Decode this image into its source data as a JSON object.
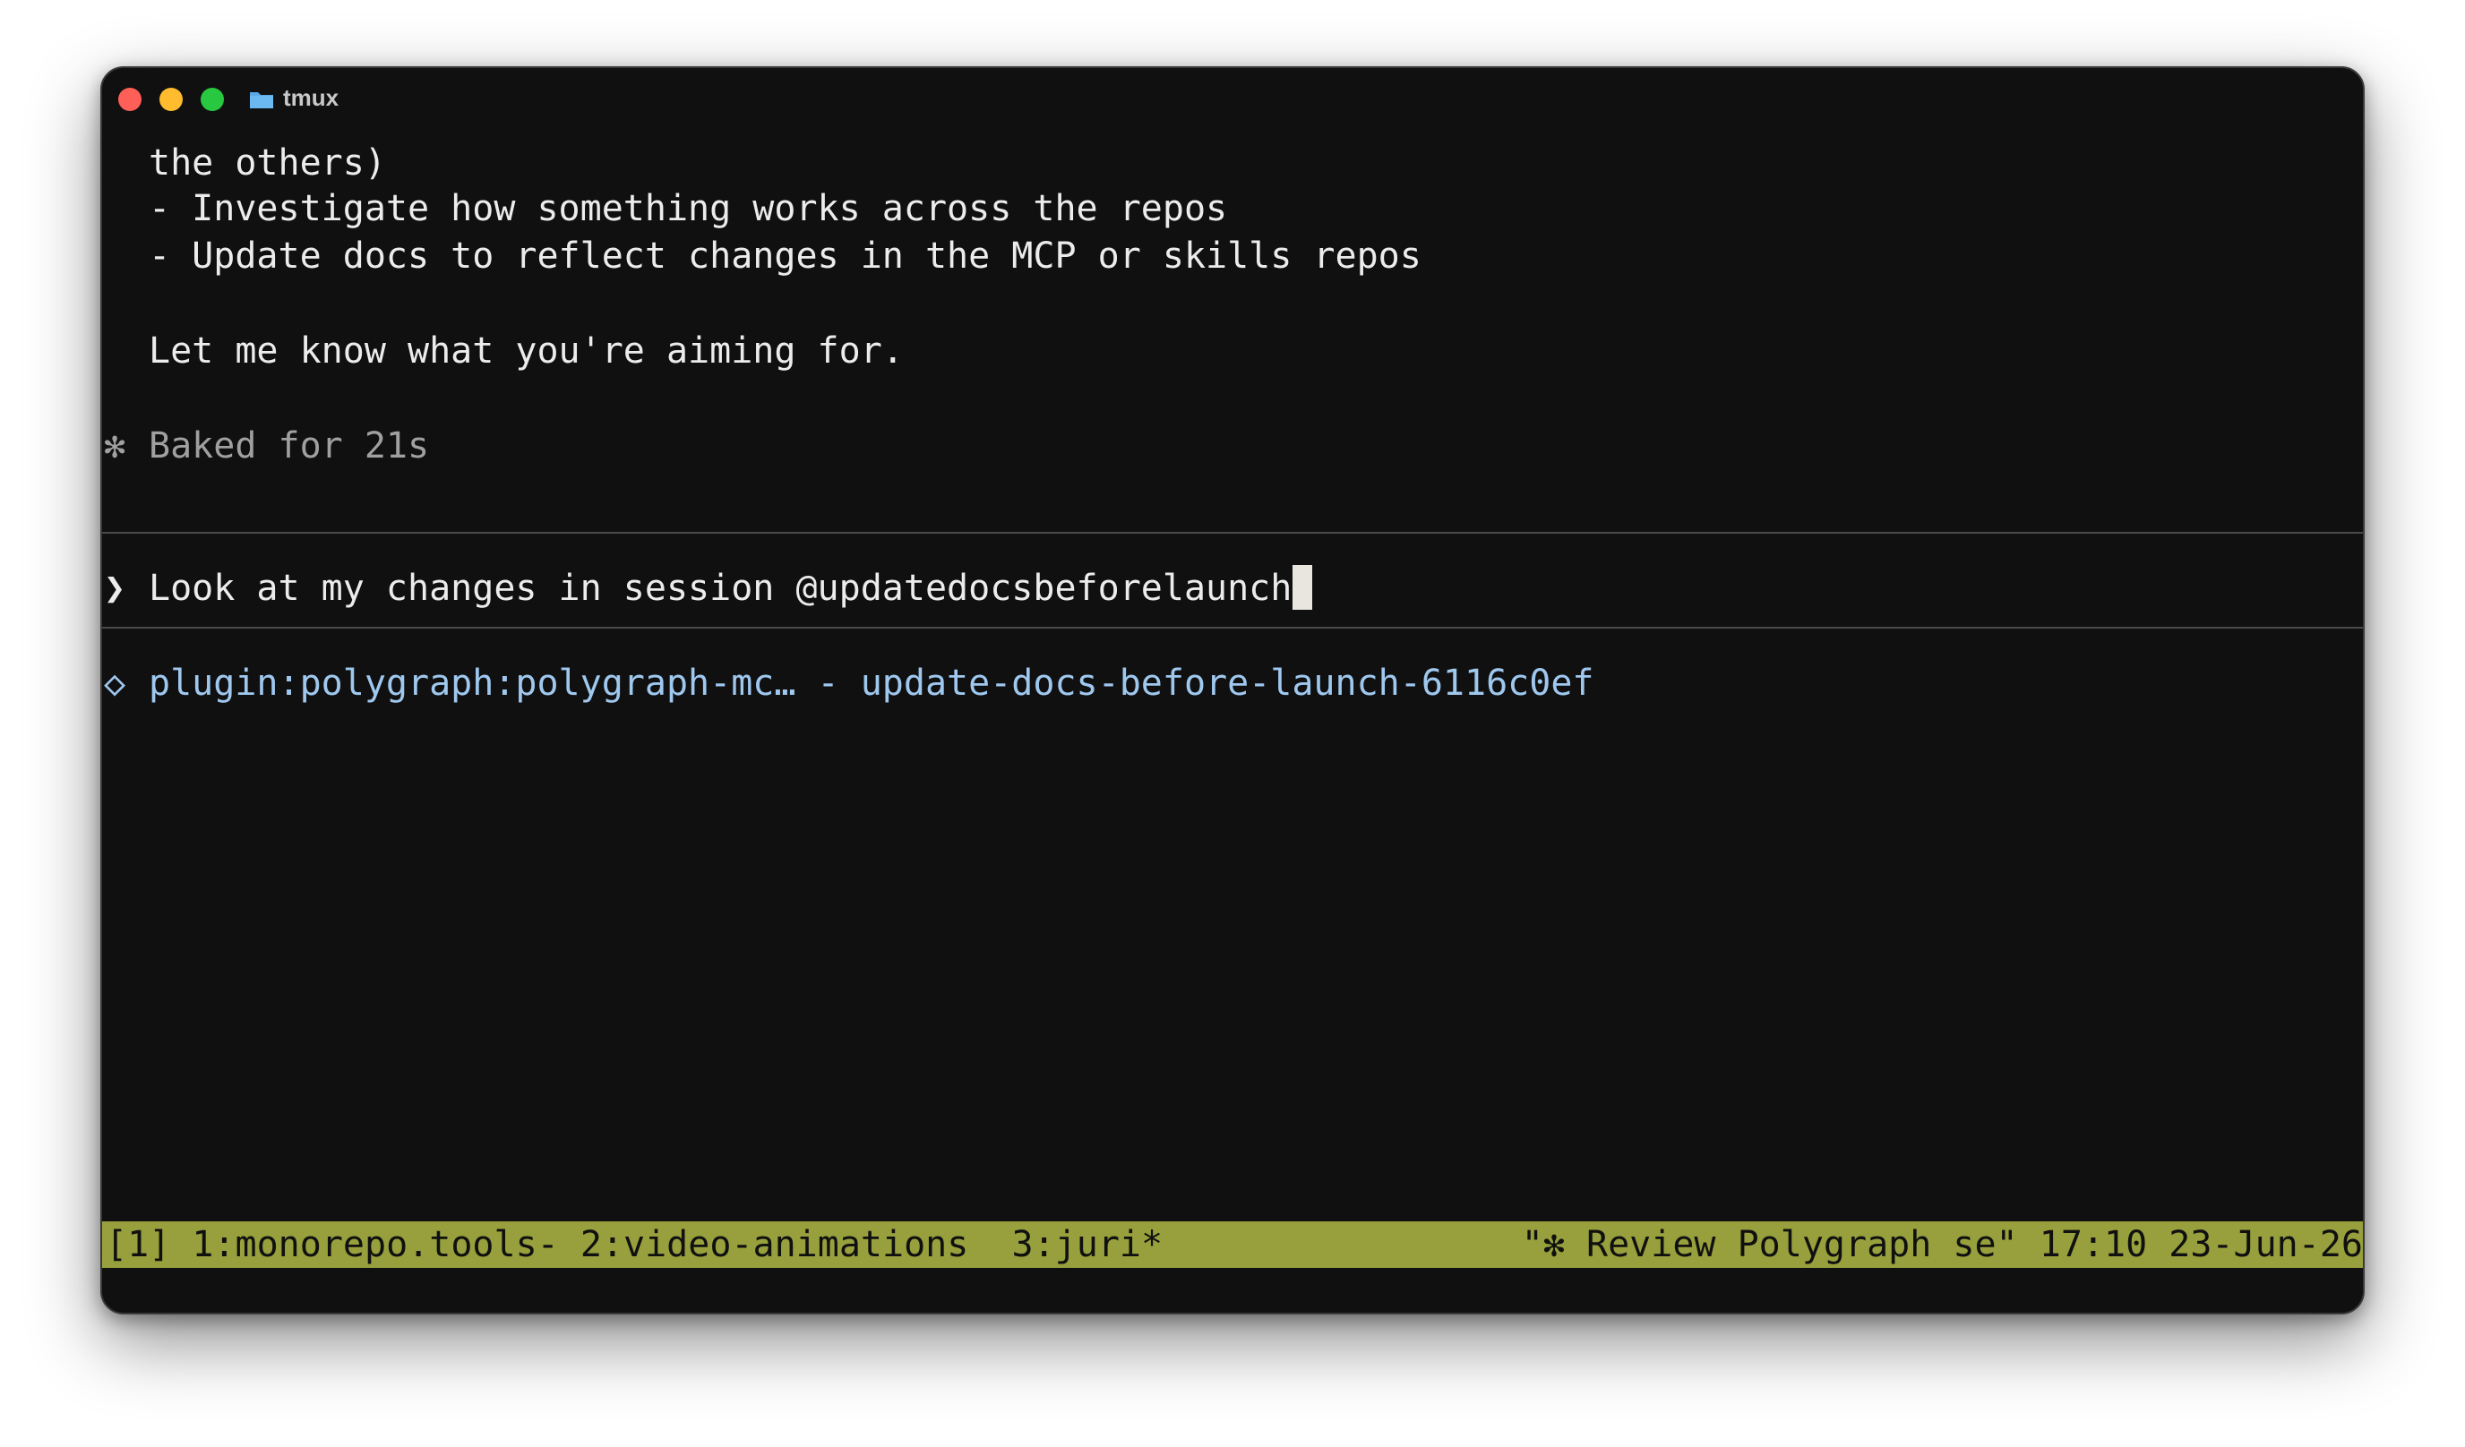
{
  "window": {
    "title": "tmux",
    "title_icon": "folder-icon"
  },
  "terminal": {
    "lines": [
      "the others)",
      "- Investigate how something works across the repos",
      "- Update docs to reflect changes in the MCP or skills repos",
      "Let me know what you're aiming for."
    ],
    "status_marker": "✻",
    "status_text": "Baked for 21s",
    "prompt_marker": "❯",
    "prompt_text": "Look at my changes in session @updatedocsbeforelaunch",
    "suggestion_marker": "◇",
    "suggestion_text": "plugin:polygraph:polygraph-mc… - update-docs-before-launch-6116c0ef"
  },
  "tmux": {
    "session": "[1]",
    "windows": [
      "1:monorepo.tools-",
      "2:video-animations",
      "3:juri*"
    ],
    "pane_title": "\"✻ Review Polygraph se\"",
    "time": "17:10",
    "date": "23-Jun-26",
    "bar_color": "#97a03c"
  }
}
